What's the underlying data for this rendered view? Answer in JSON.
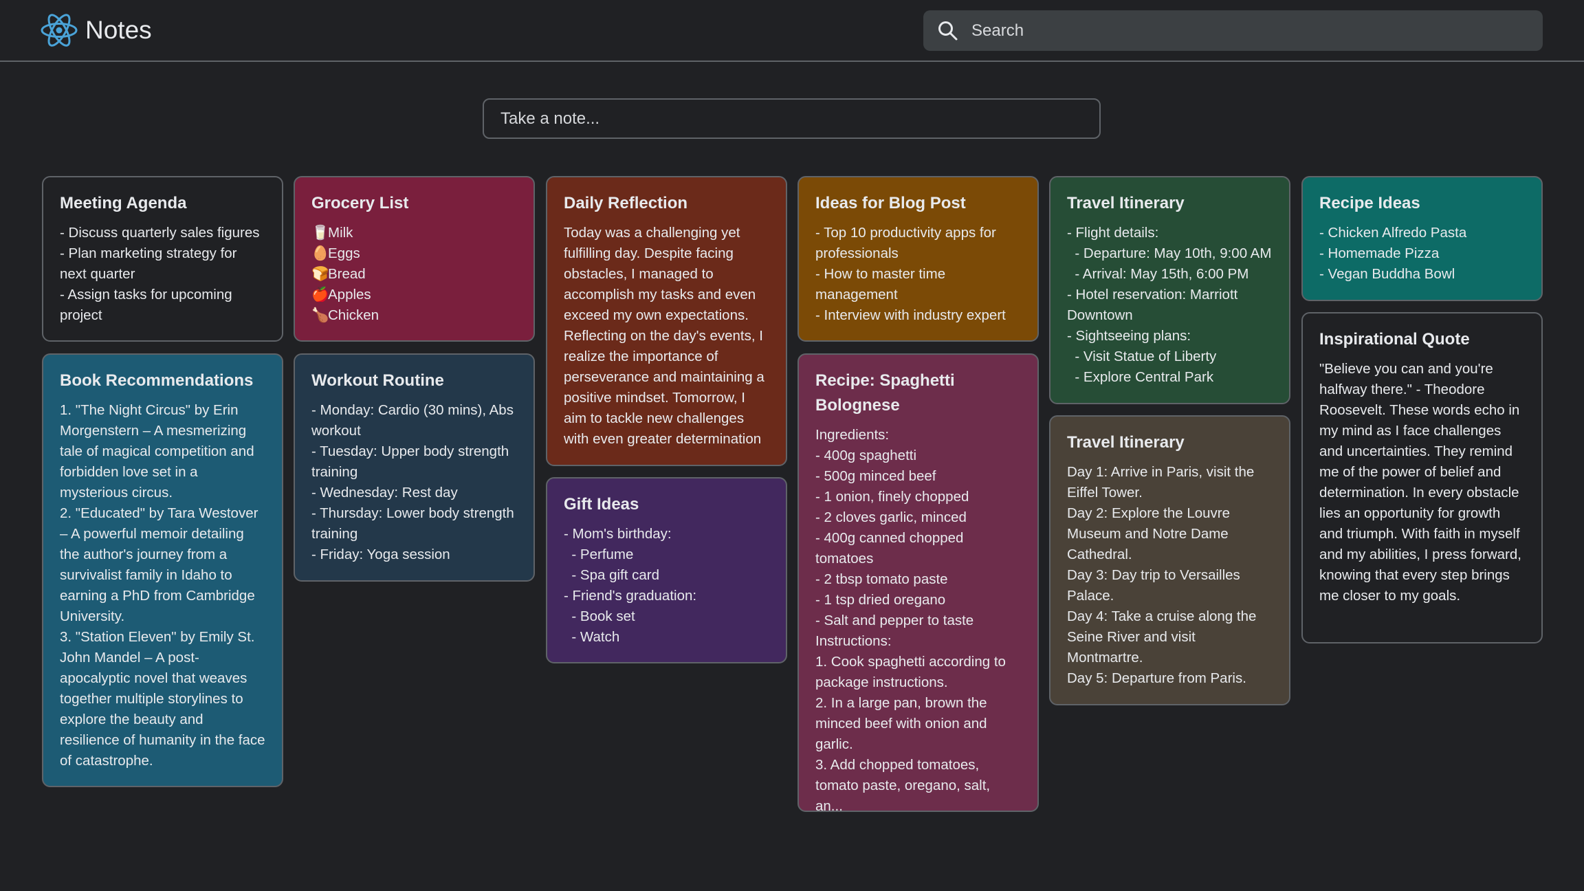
{
  "header": {
    "app_title": "Notes",
    "logo_icon": "atom-icon",
    "search_placeholder": "Search"
  },
  "composer": {
    "placeholder": "Take a note..."
  },
  "colors": {
    "background": "#202124",
    "default_note": "#202124",
    "grocery": "#7a1f3d",
    "reflection": "#6b2a1a",
    "blog": "#7b4a06",
    "travel1": "#264d36",
    "recipe_ideas": "#0d6b66",
    "books": "#1d5b74",
    "workout": "#23384a",
    "gift": "#42285e",
    "spaghetti": "#6d2d4b",
    "travel2": "#4a4238",
    "quote": "#202124"
  },
  "notes": {
    "meeting": {
      "title": "Meeting Agenda",
      "lines": [
        "- Discuss quarterly sales figures",
        "- Plan marketing strategy for next quarter",
        "- Assign tasks for upcoming project"
      ]
    },
    "grocery": {
      "title": "Grocery List",
      "items": [
        {
          "icon": "milk-icon",
          "glyph": "🥛",
          "label": "Milk"
        },
        {
          "icon": "egg-icon",
          "glyph": "🥚",
          "label": "Eggs"
        },
        {
          "icon": "bread-icon",
          "glyph": "🍞",
          "label": "Bread"
        },
        {
          "icon": "apple-icon",
          "glyph": "🍎",
          "label": "Apples"
        },
        {
          "icon": "chicken-icon",
          "glyph": "🍗",
          "label": "Chicken"
        }
      ]
    },
    "reflection": {
      "title": "Daily Reflection",
      "body": "Today was a challenging yet fulfilling day. Despite facing obstacles, I managed to accomplish my tasks and even exceed my own expectations. Reflecting on the day's events, I realize the importance of perseverance and maintaining a positive mindset. Tomorrow, I aim to tackle new challenges with even greater determination"
    },
    "blog": {
      "title": "Ideas for Blog Post",
      "lines": [
        "- Top 10 productivity apps for professionals",
        "- How to master time management",
        "- Interview with industry expert"
      ]
    },
    "travel1": {
      "title": "Travel Itinerary",
      "lines": [
        "- Flight details:",
        "  - Departure: May 10th, 9:00 AM",
        "  - Arrival: May 15th, 6:00 PM",
        "- Hotel reservation: Marriott Downtown",
        "- Sightseeing plans:",
        "  - Visit Statue of Liberty",
        "  - Explore Central Park"
      ]
    },
    "recipe_ideas": {
      "title": "Recipe Ideas",
      "lines": [
        "- Chicken Alfredo Pasta",
        "- Homemade Pizza",
        "- Vegan Buddha Bowl"
      ]
    },
    "books": {
      "title": "Book Recommendations",
      "lines": [
        "1. \"The Night Circus\" by Erin Morgenstern – A mesmerizing tale of magical competition and forbidden love set in a mysterious circus.",
        "2. \"Educated\" by Tara Westover – A powerful memoir detailing the author's journey from a survivalist family in Idaho to earning a PhD from Cambridge University.",
        "3. \"Station Eleven\" by Emily St. John Mandel – A post-apocalyptic novel that weaves together multiple storylines to explore the beauty and resilience of humanity in the face of catastrophe."
      ]
    },
    "workout": {
      "title": "Workout Routine",
      "lines": [
        "- Monday: Cardio (30 mins), Abs workout",
        "- Tuesday: Upper body strength training",
        "- Wednesday: Rest day",
        "- Thursday: Lower body strength training",
        "- Friday: Yoga session"
      ]
    },
    "gift": {
      "title": "Gift Ideas",
      "lines": [
        "- Mom's birthday:",
        "  - Perfume",
        "  - Spa gift card",
        "- Friend's graduation:",
        "  - Book set",
        "  - Watch"
      ]
    },
    "spaghetti": {
      "title": "Recipe: Spaghetti Bolognese",
      "lines": [
        "Ingredients:",
        "- 400g spaghetti",
        "- 500g minced beef",
        "- 1 onion, finely chopped",
        "- 2 cloves garlic, minced",
        "- 400g canned chopped tomatoes",
        "- 2 tbsp tomato paste",
        "- 1 tsp dried oregano",
        "- Salt and pepper to taste",
        "Instructions:",
        "1. Cook spaghetti according to package instructions.",
        "2. In a large pan, brown the minced beef with onion and garlic.",
        "3. Add chopped tomatoes, tomato paste, oregano, salt, an..."
      ]
    },
    "travel2": {
      "title": "Travel Itinerary",
      "lines": [
        "Day 1: Arrive in Paris, visit the Eiffel Tower.",
        "Day 2: Explore the Louvre Museum and Notre Dame Cathedral.",
        "Day 3: Day trip to Versailles Palace.",
        "Day 4: Take a cruise along the Seine River and visit Montmartre.",
        "Day 5: Departure from Paris."
      ]
    },
    "quote": {
      "title": "Inspirational Quote",
      "body": "\"Believe you can and you're halfway there.\" - Theodore Roosevelt. These words echo in my mind as I face challenges and uncertainties. They remind me of the power of belief and determination. In every obstacle lies an opportunity for growth and triumph. With faith in myself and my abilities, I press forward, knowing that every step brings me closer to my goals."
    }
  }
}
